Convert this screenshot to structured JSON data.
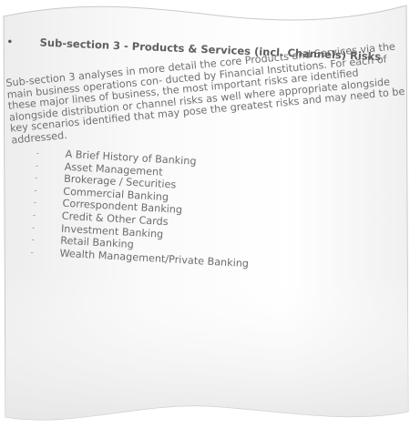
{
  "document": {
    "heading": {
      "bullet": "•",
      "text": "Sub-section 3 - Products & Services (incl. Channels) Risks"
    },
    "paragraph": "Sub-section 3 analyses in more detail the core Products and Services via the main business operations con- ducted by Financial Institutions. For each of these major lines of business, the most important risks are identified alongside distribution or channel risks as well where appropriate alongside key scenarios identified that may pose the greatest risks and may need to be addressed.",
    "list_marker": "‐",
    "items": [
      "A Brief History of Banking",
      "Asset Management",
      "Brokerage / Securities",
      "Commercial Banking",
      "Correspondent Banking",
      "Credit & Other Cards",
      "Investment Banking",
      "Retail Banking",
      "Wealth Management/Private Banking"
    ]
  },
  "colors": {
    "paper_edge": "#c9c9c9",
    "paper_shadow": "#d9d9d9",
    "text": "#6f6f6f"
  }
}
